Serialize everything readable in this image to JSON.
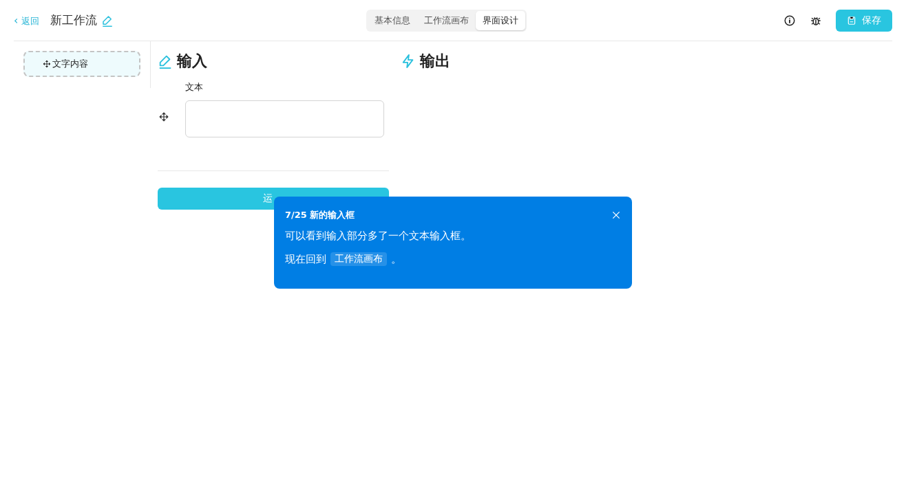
{
  "header": {
    "back": {
      "icon": "‹",
      "label": "返回"
    },
    "title": "新工作流",
    "tabs": [
      {
        "label": "基本信息",
        "selected": false
      },
      {
        "label": "工作流画布",
        "selected": false
      },
      {
        "label": "界面设计",
        "selected": true
      }
    ],
    "save": "保存"
  },
  "sidebar": {
    "items": [
      {
        "label": "文字内容"
      }
    ]
  },
  "input_section": {
    "title": "输入",
    "fields": [
      {
        "label": "文本"
      }
    ],
    "run": "运"
  },
  "output_section": {
    "title": "输出"
  },
  "tour": {
    "step": "7/25",
    "title": "新的输入框",
    "body": "可以看到输入部分多了一个文本输入框。",
    "action_prefix": "现在回到",
    "action_tag": "工作流画布",
    "action_suffix": "。"
  }
}
